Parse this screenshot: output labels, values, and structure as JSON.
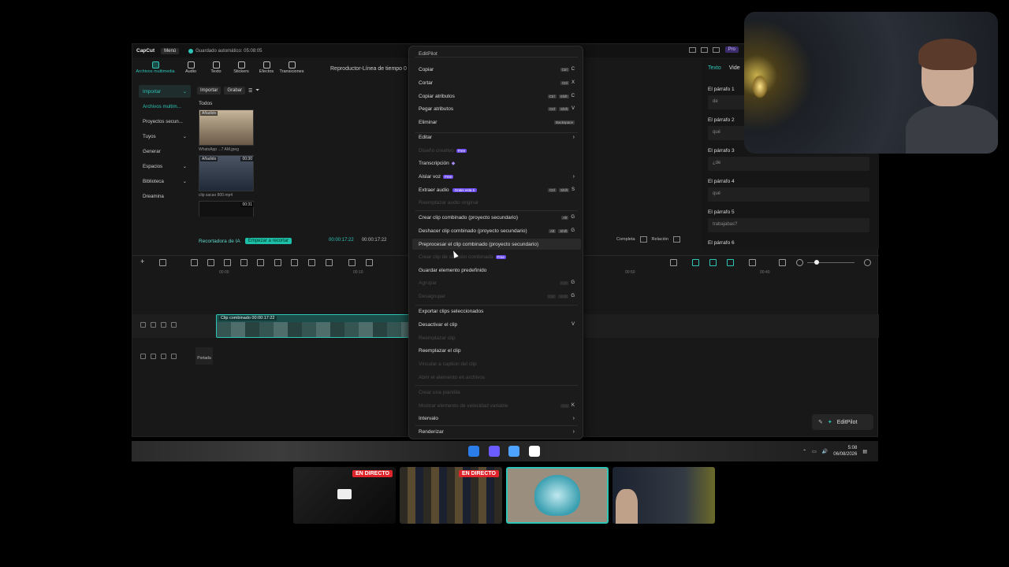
{
  "app": {
    "logo": "CapCut",
    "menu_label": "Menú",
    "autosave_text": "Guardado automático: 05:08:05",
    "pro_label": "Pro"
  },
  "media_tabs": [
    {
      "label": "Archivos multimedia",
      "icon": "media-icon"
    },
    {
      "label": "Audio",
      "icon": "audio-icon"
    },
    {
      "label": "Texto",
      "icon": "text-icon"
    },
    {
      "label": "Stickers",
      "icon": "sticker-icon"
    },
    {
      "label": "Efectos",
      "icon": "effects-icon"
    },
    {
      "label": "Transiciones",
      "icon": "transitions-icon"
    }
  ],
  "sidebar": {
    "items": [
      {
        "label": "Importar"
      },
      {
        "label": "Archivos multim..."
      },
      {
        "label": "Proyectos secun..."
      },
      {
        "label": "Tuyos"
      },
      {
        "label": "Generar"
      },
      {
        "label": "Espacios"
      },
      {
        "label": "Biblioteca"
      },
      {
        "label": "Dreamina"
      }
    ]
  },
  "media": {
    "import_label": "Importar",
    "record_label": "Grabar",
    "all_label": "Todos",
    "thumbs": [
      {
        "tag": "Añadido",
        "duration": "",
        "label": "WhatsApp ...7 AM.jpeg"
      },
      {
        "tag": "Añadido",
        "duration": "00:30",
        "label": "clip sacao 800.mp4"
      },
      {
        "tag": "",
        "duration": "00:31",
        "label": ""
      }
    ],
    "ai_cutter": "Recortadora de IA",
    "ai_start_btn": "Empezar a recortar"
  },
  "player": {
    "title": "Reproductor-Línea de tiempo 0",
    "time_current": "00:00:17:22",
    "time_total": "00:00:17:22",
    "full_label": "Completa",
    "ratio_label": "Relación"
  },
  "right_panel": {
    "tabs": [
      "Texto",
      "Vide"
    ],
    "paragraphs": [
      {
        "title": "El párrafo 1",
        "text": "de"
      },
      {
        "title": "El párrafo 2",
        "text": "qué"
      },
      {
        "title": "El párrafo 3",
        "text": "¿de"
      },
      {
        "title": "El párrafo 4",
        "text": "qué"
      },
      {
        "title": "El párrafo 5",
        "text": "trabajabas?"
      },
      {
        "title": "El párrafo 6",
        "text": ""
      }
    ]
  },
  "timeline": {
    "ruler": [
      "00:00",
      "00:10",
      "00:50",
      "00:40"
    ],
    "clip_label": "Clip combinado  00:00:17:22",
    "cover_label": "Portada",
    "editpilot_btn": "EditPilot"
  },
  "context_menu": {
    "header": "EditPilot",
    "items": [
      {
        "label": "Copiar",
        "keys": [
          "Ctrl"
        ],
        "key": "C",
        "disabled": false
      },
      {
        "label": "Cortar",
        "keys": [
          "Ctrl"
        ],
        "key": "X",
        "disabled": false
      },
      {
        "label": "Copiar atributos",
        "keys": [
          "Ctrl",
          "Shift"
        ],
        "key": "C",
        "disabled": false
      },
      {
        "label": "Pegar atributos",
        "keys": [
          "Ctrl",
          "Shift"
        ],
        "key": "V",
        "disabled": false
      },
      {
        "label": "Eliminar",
        "keys": [
          "Backspace"
        ],
        "key": "",
        "disabled": false
      },
      {
        "label": "Editar",
        "submenu": true,
        "disabled": false
      },
      {
        "label": "Diseño creativo",
        "badge": "Free",
        "disabled": true
      },
      {
        "label": "Transcripción",
        "gem": true,
        "disabled": false
      },
      {
        "label": "Aislar voz",
        "badge": "Free",
        "submenu": true,
        "disabled": false
      },
      {
        "label": "Extraer audio",
        "badge": "Gratis esta ti",
        "keys": [
          "Ctrl",
          "Shift"
        ],
        "key": "S",
        "disabled": false
      },
      {
        "label": "Reemplazar audio original",
        "disabled": true
      },
      {
        "label": "Crear clip combinado (proyecto secundario)",
        "keys": [
          "Alt"
        ],
        "key": "G",
        "disabled": false
      },
      {
        "label": "Deshacer clip combinado (proyecto secundario)",
        "keys": [
          "Alt",
          "Shift"
        ],
        "key": "G",
        "disabled": false
      },
      {
        "label": "Preprocesar el clip combinado (proyecto secundario)",
        "highlight": true,
        "disabled": false
      },
      {
        "label": "Crear clip de canción combinada",
        "badge": "Free",
        "disabled": true
      },
      {
        "label": "Guardar elemento predefinido",
        "disabled": false
      },
      {
        "label": "Agrupar",
        "keys": [
          "Ctrl"
        ],
        "key": "G",
        "disabled": true
      },
      {
        "label": "Desagrupar",
        "keys": [
          "Ctrl",
          "Shift"
        ],
        "key": "G",
        "disabled": true
      },
      {
        "label": "Exportar clips seleccionados",
        "disabled": false
      },
      {
        "label": "Desactivar el clip",
        "key": "V",
        "disabled": false
      },
      {
        "label": "Reemplazar clip",
        "disabled": true
      },
      {
        "label": "Reemplazar el clip",
        "disabled": false
      },
      {
        "label": "Vincular a caption del clip",
        "disabled": true
      },
      {
        "label": "Abrir el elemento en archivos",
        "disabled": true
      },
      {
        "label": "Crear una plantilla",
        "disabled": true
      },
      {
        "label": "Mostrar elemento de velocidad variable",
        "keys": [
          "Ctrl"
        ],
        "key": "K",
        "disabled": true
      },
      {
        "label": "Intervalo",
        "submenu": true,
        "disabled": false
      },
      {
        "label": "Renderizar",
        "submenu": true,
        "disabled": false
      }
    ]
  },
  "taskbar": {
    "time": "5:08",
    "date": "06/08/2026"
  },
  "scenes": [
    {
      "live": "EN DIRECTO"
    },
    {
      "live": "EN DIRECTO"
    },
    {
      "live": ""
    },
    {
      "live": ""
    }
  ]
}
